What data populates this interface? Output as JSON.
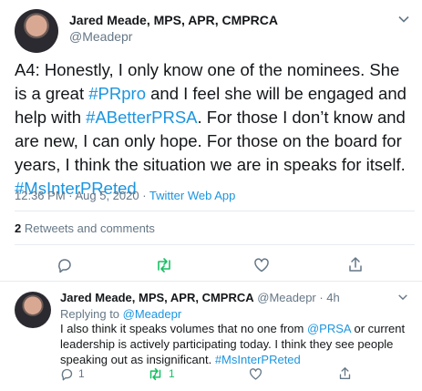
{
  "tweet": {
    "name": "Jared Meade, MPS, APR, CMPRCA",
    "handle": "@Meadepr",
    "text_parts": [
      "A4: Honestly, I only know one of the nominees. She is a great ",
      "#PRpro",
      " and I feel she will be engaged and help with ",
      "#ABetterPRSA",
      ". For those I don’t know and are new, I can only hope. For those on the board for years, I think the situation we are in speaks for itself. ",
      "#MsInterPReted"
    ],
    "time": "12:36 PM · Aug 5, 2020 · ",
    "source": "Twitter Web App",
    "retweets_count": "2",
    "retweets_label": " Retweets and comments"
  },
  "reply": {
    "name": "Jared Meade, MPS, APR, CMPRCA",
    "handle_time": "@Meadepr · 4h",
    "replying_to_label": "Replying to ",
    "replying_to_handle": "@Meadepr",
    "text_parts": [
      "I also think it speaks volumes that no one from ",
      "@PRSA",
      " or current leadership is actively participating today. I think they see people speaking out as insignificant. ",
      "#MsInterPReted"
    ],
    "reply_count": "1",
    "retweet_count": "1"
  },
  "colors": {
    "link": "#1b95e0",
    "retweet_active": "#17bf63",
    "muted": "#657786"
  }
}
